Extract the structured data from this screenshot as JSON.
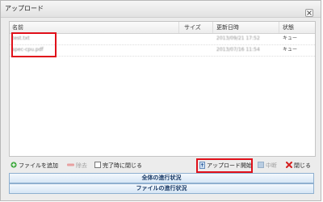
{
  "window": {
    "title": "アップロード"
  },
  "list": {
    "columns": [
      "名前",
      "サイズ",
      "更新日時",
      "状態"
    ],
    "rows": [
      {
        "name": "test.txt",
        "size": "",
        "modified": "2013/09/21 17:52",
        "status": "キュー"
      },
      {
        "name": "spec-cpu.pdf",
        "size": "",
        "modified": "2013/07/16 11:54",
        "status": "キュー"
      }
    ]
  },
  "toolbar": {
    "add_file": "ファイルを追加",
    "remove": "除去",
    "close_on_complete": "完了時に閉じる",
    "start_upload": "アップロード開始",
    "cancel": "中断",
    "close": "閉じる"
  },
  "progress": {
    "overall": "全体の進行状況",
    "file": "ファイルの進行状況"
  },
  "colors": {
    "highlight": "#e0101a",
    "add_icon": "#3aa63a",
    "remove_icon": "#e06060",
    "close_icon": "#d42020"
  }
}
